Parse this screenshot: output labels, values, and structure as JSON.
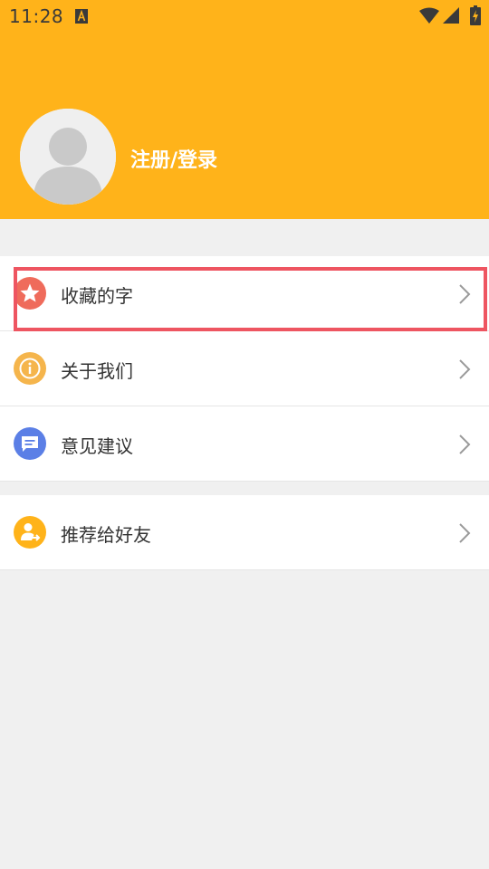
{
  "status_bar": {
    "time": "11:28",
    "icons": [
      "a-notification-icon",
      "wifi-icon",
      "signal-icon",
      "battery-charging-icon"
    ]
  },
  "header": {
    "background_color": "#ffb31a",
    "login_label": "注册/登录",
    "avatar_icon": "person-placeholder-icon"
  },
  "menu": {
    "group1": [
      {
        "label": "收藏的字",
        "icon": "star-icon",
        "icon_color": "#ef6b5b"
      },
      {
        "label": "关于我们",
        "icon": "info-icon",
        "icon_color": "#f5b54c"
      },
      {
        "label": "意见建议",
        "icon": "message-icon",
        "icon_color": "#5b7fe6"
      }
    ],
    "group2": [
      {
        "label": "推荐给好友",
        "icon": "share-user-icon",
        "icon_color": "#ffb31a"
      }
    ]
  },
  "highlight_color": "#ee5561"
}
